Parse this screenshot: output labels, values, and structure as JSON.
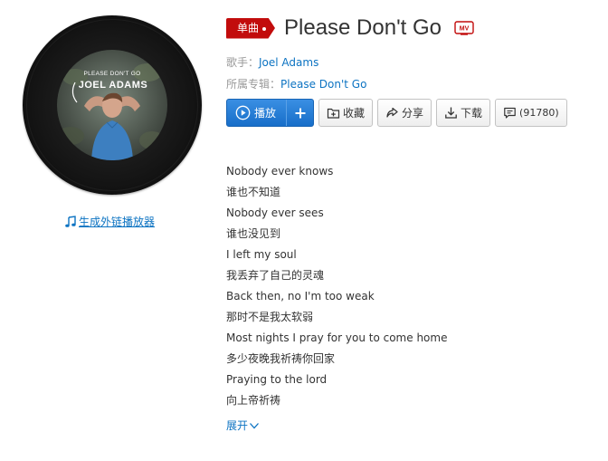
{
  "cover": {
    "album_text_line1": "PLEASE DON'T GO",
    "album_text_line2": "JOEL ADAMS"
  },
  "outlink": {
    "label": "生成外链播放器",
    "icon": "music-note-icon"
  },
  "song": {
    "type_tag": "单曲",
    "title": "Please Don't Go",
    "mv_icon": "mv-icon"
  },
  "singer": {
    "label": "歌手：",
    "name": "Joel Adams"
  },
  "album": {
    "label": "所属专辑：",
    "name": "Please Don't Go"
  },
  "actions": {
    "play_label": "播放",
    "add_icon": "plus-icon",
    "collect_label": "收藏",
    "share_label": "分享",
    "download_label": "下载",
    "comment_count": "(91780)"
  },
  "lyrics": [
    "Nobody ever knows",
    "谁也不知道",
    "Nobody ever sees",
    "谁也没见到",
    "I left my soul",
    "我丢弃了自己的灵魂",
    "Back then, no I'm too weak",
    "那时不是我太软弱",
    "Most nights I pray for you to come home",
    "多少夜晚我祈祷你回家",
    "Praying to the lord",
    "向上帝祈祷"
  ],
  "expand_label": "展开",
  "colors": {
    "accent_red": "#c20c0c",
    "link_blue": "#0c73c2",
    "play_blue": "#2a80d8"
  }
}
